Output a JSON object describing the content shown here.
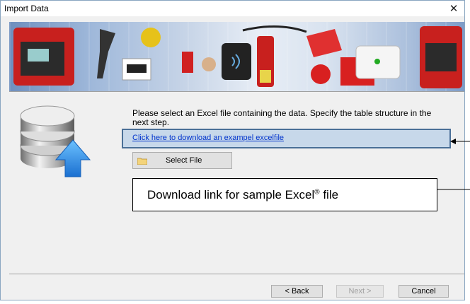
{
  "window": {
    "title": "Import Data",
    "close_icon": "close-icon"
  },
  "banner": {
    "description_icon": "product-banner-image"
  },
  "main": {
    "message": "Please select an Excel file containing the data. Specify the table structure in the next step.",
    "download_link": "Click here to download an exampel excelfile",
    "select_file_label": "Select File"
  },
  "callout": {
    "text": "Download link for sample Excel",
    "superscript": "®",
    "suffix": " file"
  },
  "footer": {
    "back_label": "< Back",
    "next_label": "Next >",
    "cancel_label": "Cancel"
  },
  "colors": {
    "link": "#0033cc",
    "highlight_border": "#4a6f97",
    "highlight_fill": "#c7d8ea",
    "db_arrow": "#2a8fe0"
  }
}
